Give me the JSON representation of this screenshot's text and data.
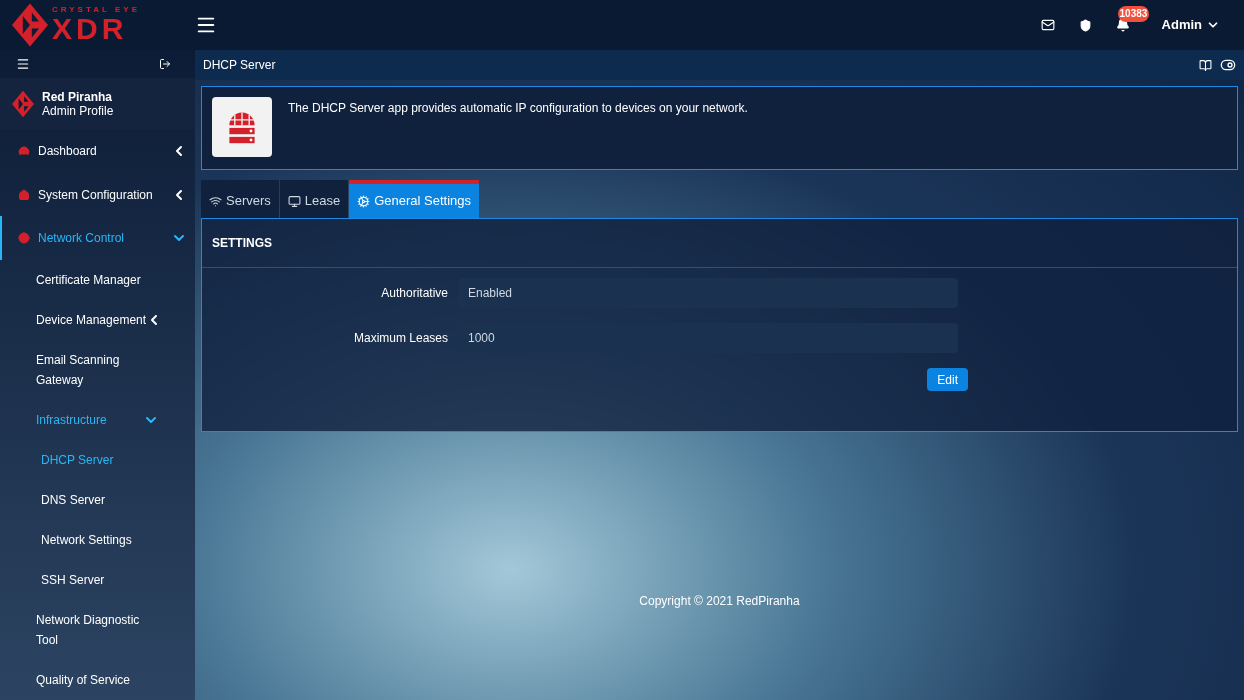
{
  "logo": {
    "top": "CRYSTAL EYE",
    "main": "XDR"
  },
  "topbar": {
    "notifications": "10383",
    "user": "Admin"
  },
  "profile": {
    "name": "Red Piranha",
    "role": "Admin Profile"
  },
  "sidebar": {
    "items": [
      {
        "label": "Dashboard",
        "expanded": false,
        "selected": false
      },
      {
        "label": "System Configuration",
        "expanded": false,
        "selected": false
      },
      {
        "label": "Network Control",
        "expanded": true,
        "selected": true,
        "children": [
          {
            "label": "Certificate Manager",
            "selected": false
          },
          {
            "label": "Device Management",
            "expanded": false,
            "selected": false
          },
          {
            "label": "Email Scanning Gateway",
            "selected": false
          },
          {
            "label": "Infrastructure",
            "expanded": true,
            "selected": true,
            "children": [
              {
                "label": "DHCP Server",
                "selected": true
              },
              {
                "label": "DNS Server",
                "selected": false
              },
              {
                "label": "Network Settings",
                "selected": false
              },
              {
                "label": "SSH Server",
                "selected": false
              }
            ]
          },
          {
            "label": "Network Diagnostic Tool",
            "selected": false
          },
          {
            "label": "Quality of Service",
            "selected": false
          }
        ]
      }
    ]
  },
  "page": {
    "title": "DHCP Server",
    "description": "The DHCP Server app provides automatic IP configuration to devices on your network."
  },
  "tabs": [
    {
      "label": "Servers",
      "selected": false
    },
    {
      "label": "Lease",
      "selected": false
    },
    {
      "label": "General Settings",
      "selected": true
    }
  ],
  "settings": {
    "heading": "SETTINGS",
    "fields": [
      {
        "label": "Authoritative",
        "value": "Enabled"
      },
      {
        "label": "Maximum Leases",
        "value": "1000"
      }
    ],
    "button": "Edit"
  },
  "footer": "Copyright © 2021 RedPiranha"
}
